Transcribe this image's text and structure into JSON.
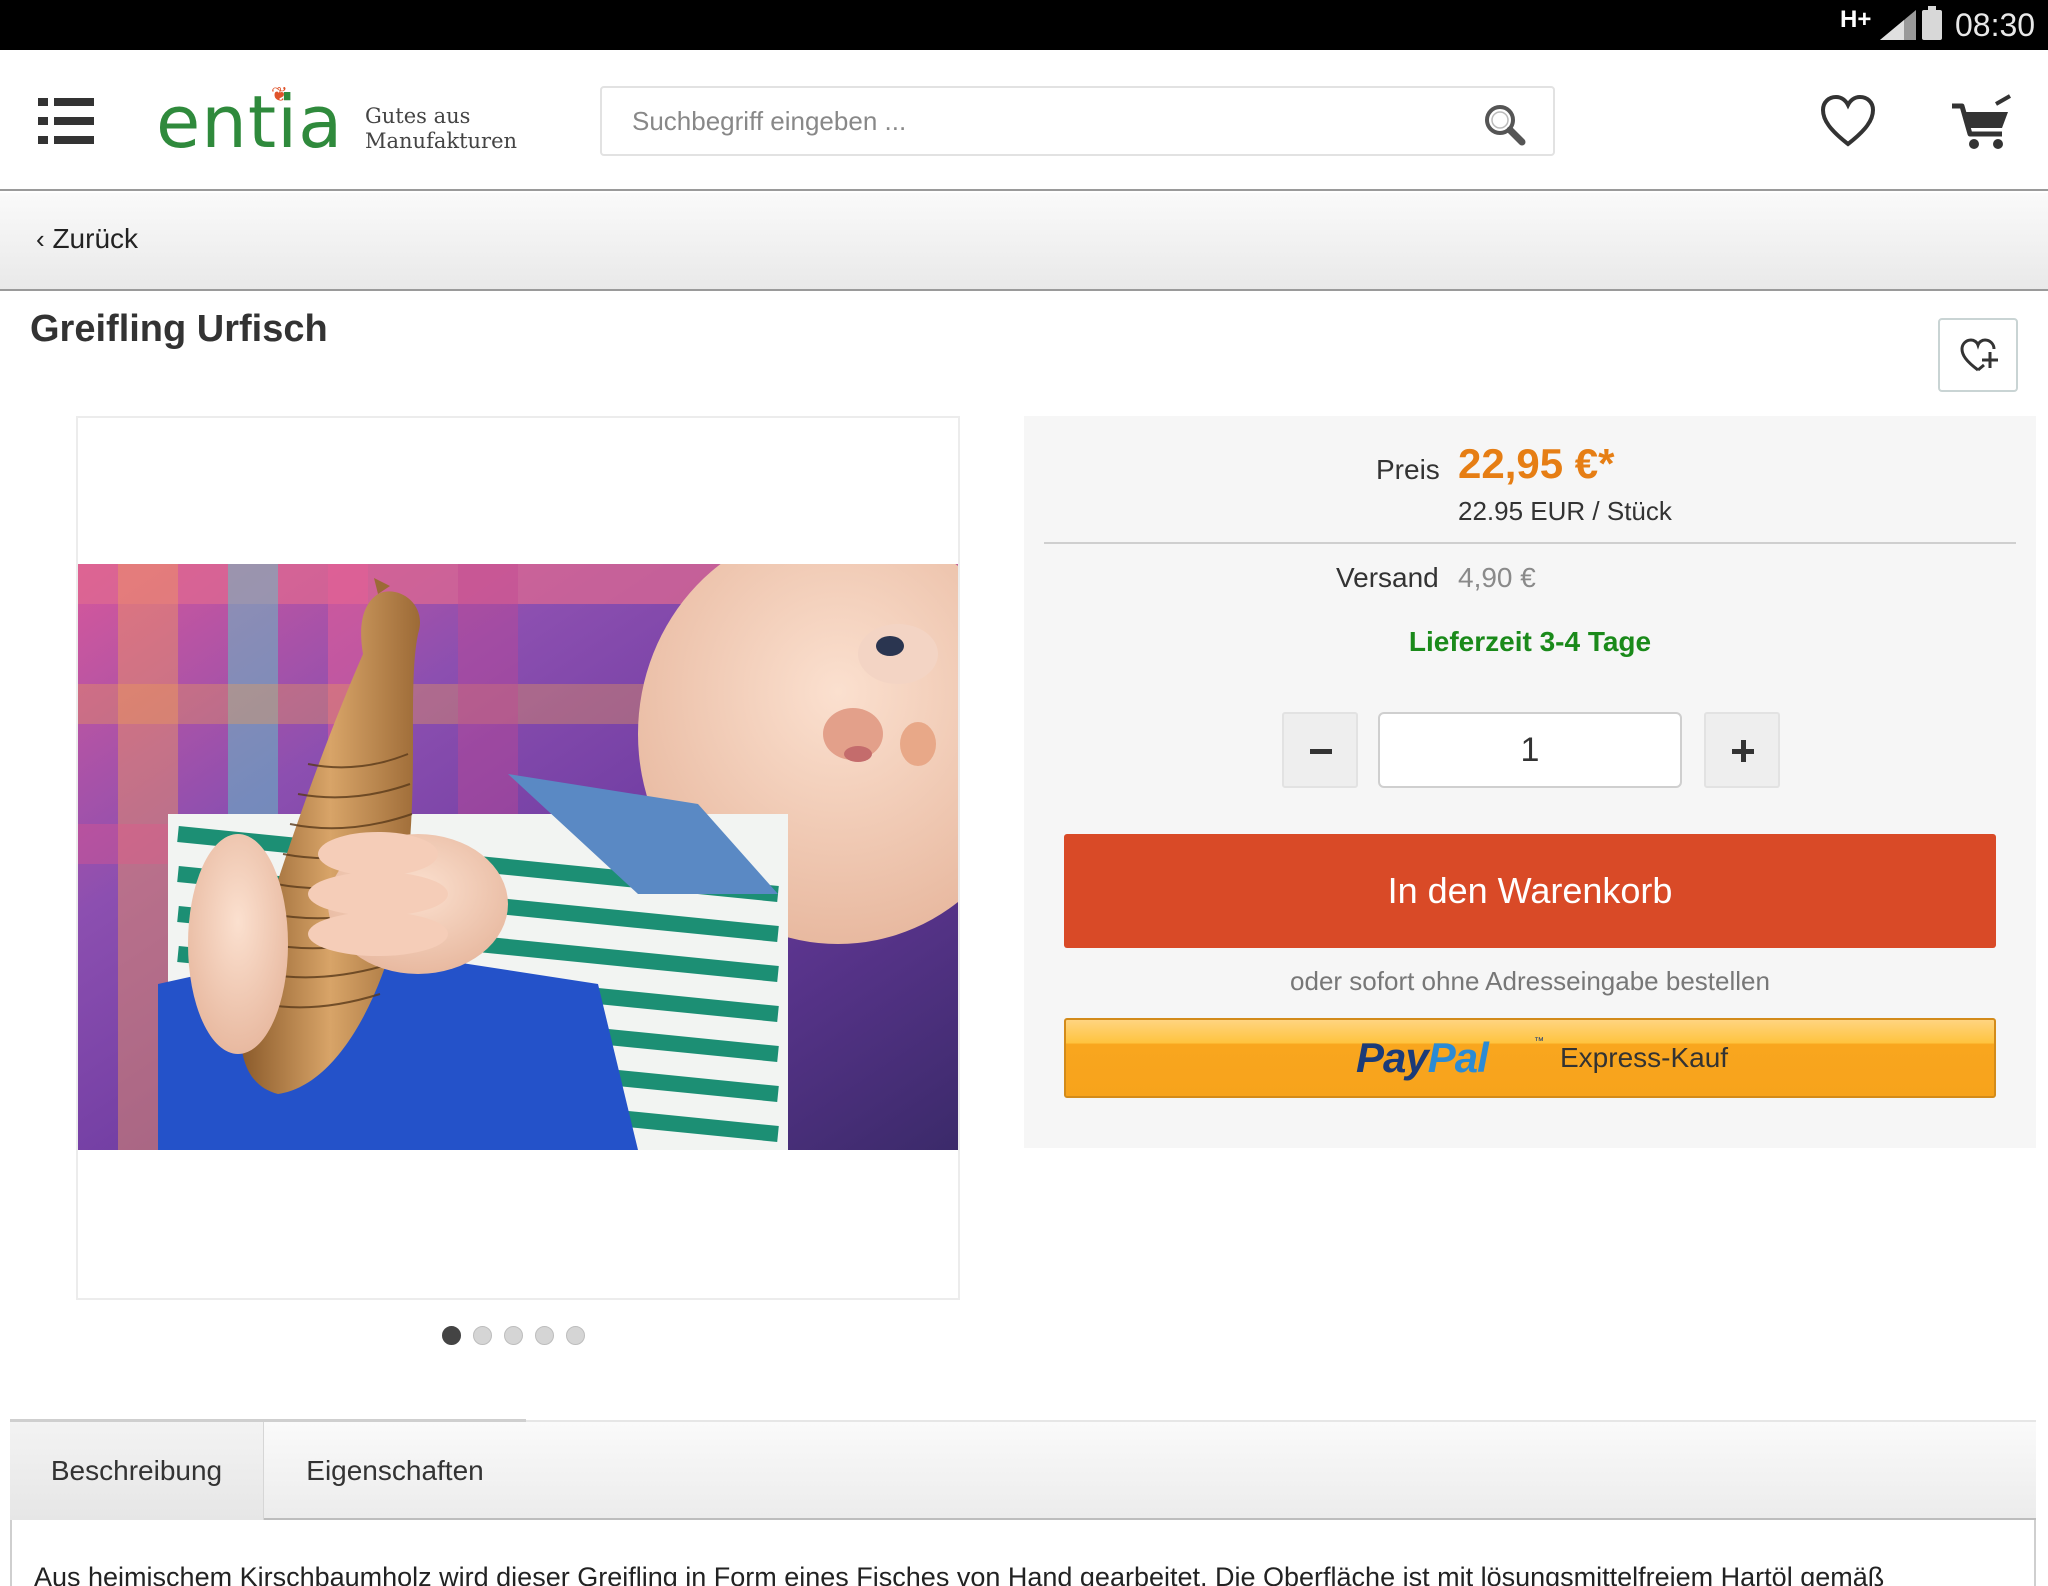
{
  "status_bar": {
    "network": "H+",
    "time": "08:30"
  },
  "header": {
    "logo": "entia",
    "tagline_line1": "Gutes aus",
    "tagline_line2": "Manufakturen",
    "search_placeholder": "Suchbegriff eingeben ...",
    "icons": [
      "menu-icon",
      "search-icon",
      "heart-icon",
      "cart-icon"
    ]
  },
  "nav": {
    "back_label": "Zurück"
  },
  "product": {
    "title": "Greifling Urfisch",
    "image_count": 5,
    "active_image": 1
  },
  "buy_box": {
    "price_label": "Preis",
    "price": "22,95 €*",
    "unit_price": "22.95 EUR / Stück",
    "shipping_label": "Versand",
    "shipping_value": "4,90 €",
    "delivery": "Lieferzeit 3-4 Tage",
    "quantity": "1",
    "cart_button": "In den Warenkorb",
    "or_text": "oder sofort ohne Adresseingabe bestellen",
    "paypal_logo_part1": "Pay",
    "paypal_logo_part2": "Pal",
    "paypal_tm": "™",
    "paypal_text": "Express-Kauf"
  },
  "tabs": [
    {
      "label": "Beschreibung",
      "active": true
    },
    {
      "label": "Eigenschaften",
      "active": false
    }
  ],
  "description": "Aus heimischem Kirschbaumholz wird dieser Greifling in Form eines Fisches von Hand gearbeitet. Die Oberfläche ist mit lösungsmittelfreiem Hartöl gemäß",
  "colors": {
    "brand_green": "#2f8a3c",
    "price_orange": "#e67e14",
    "cart_red": "#d94a27",
    "delivery_green": "#1a8a1a",
    "paypal_yellow": "#f7a31c"
  }
}
